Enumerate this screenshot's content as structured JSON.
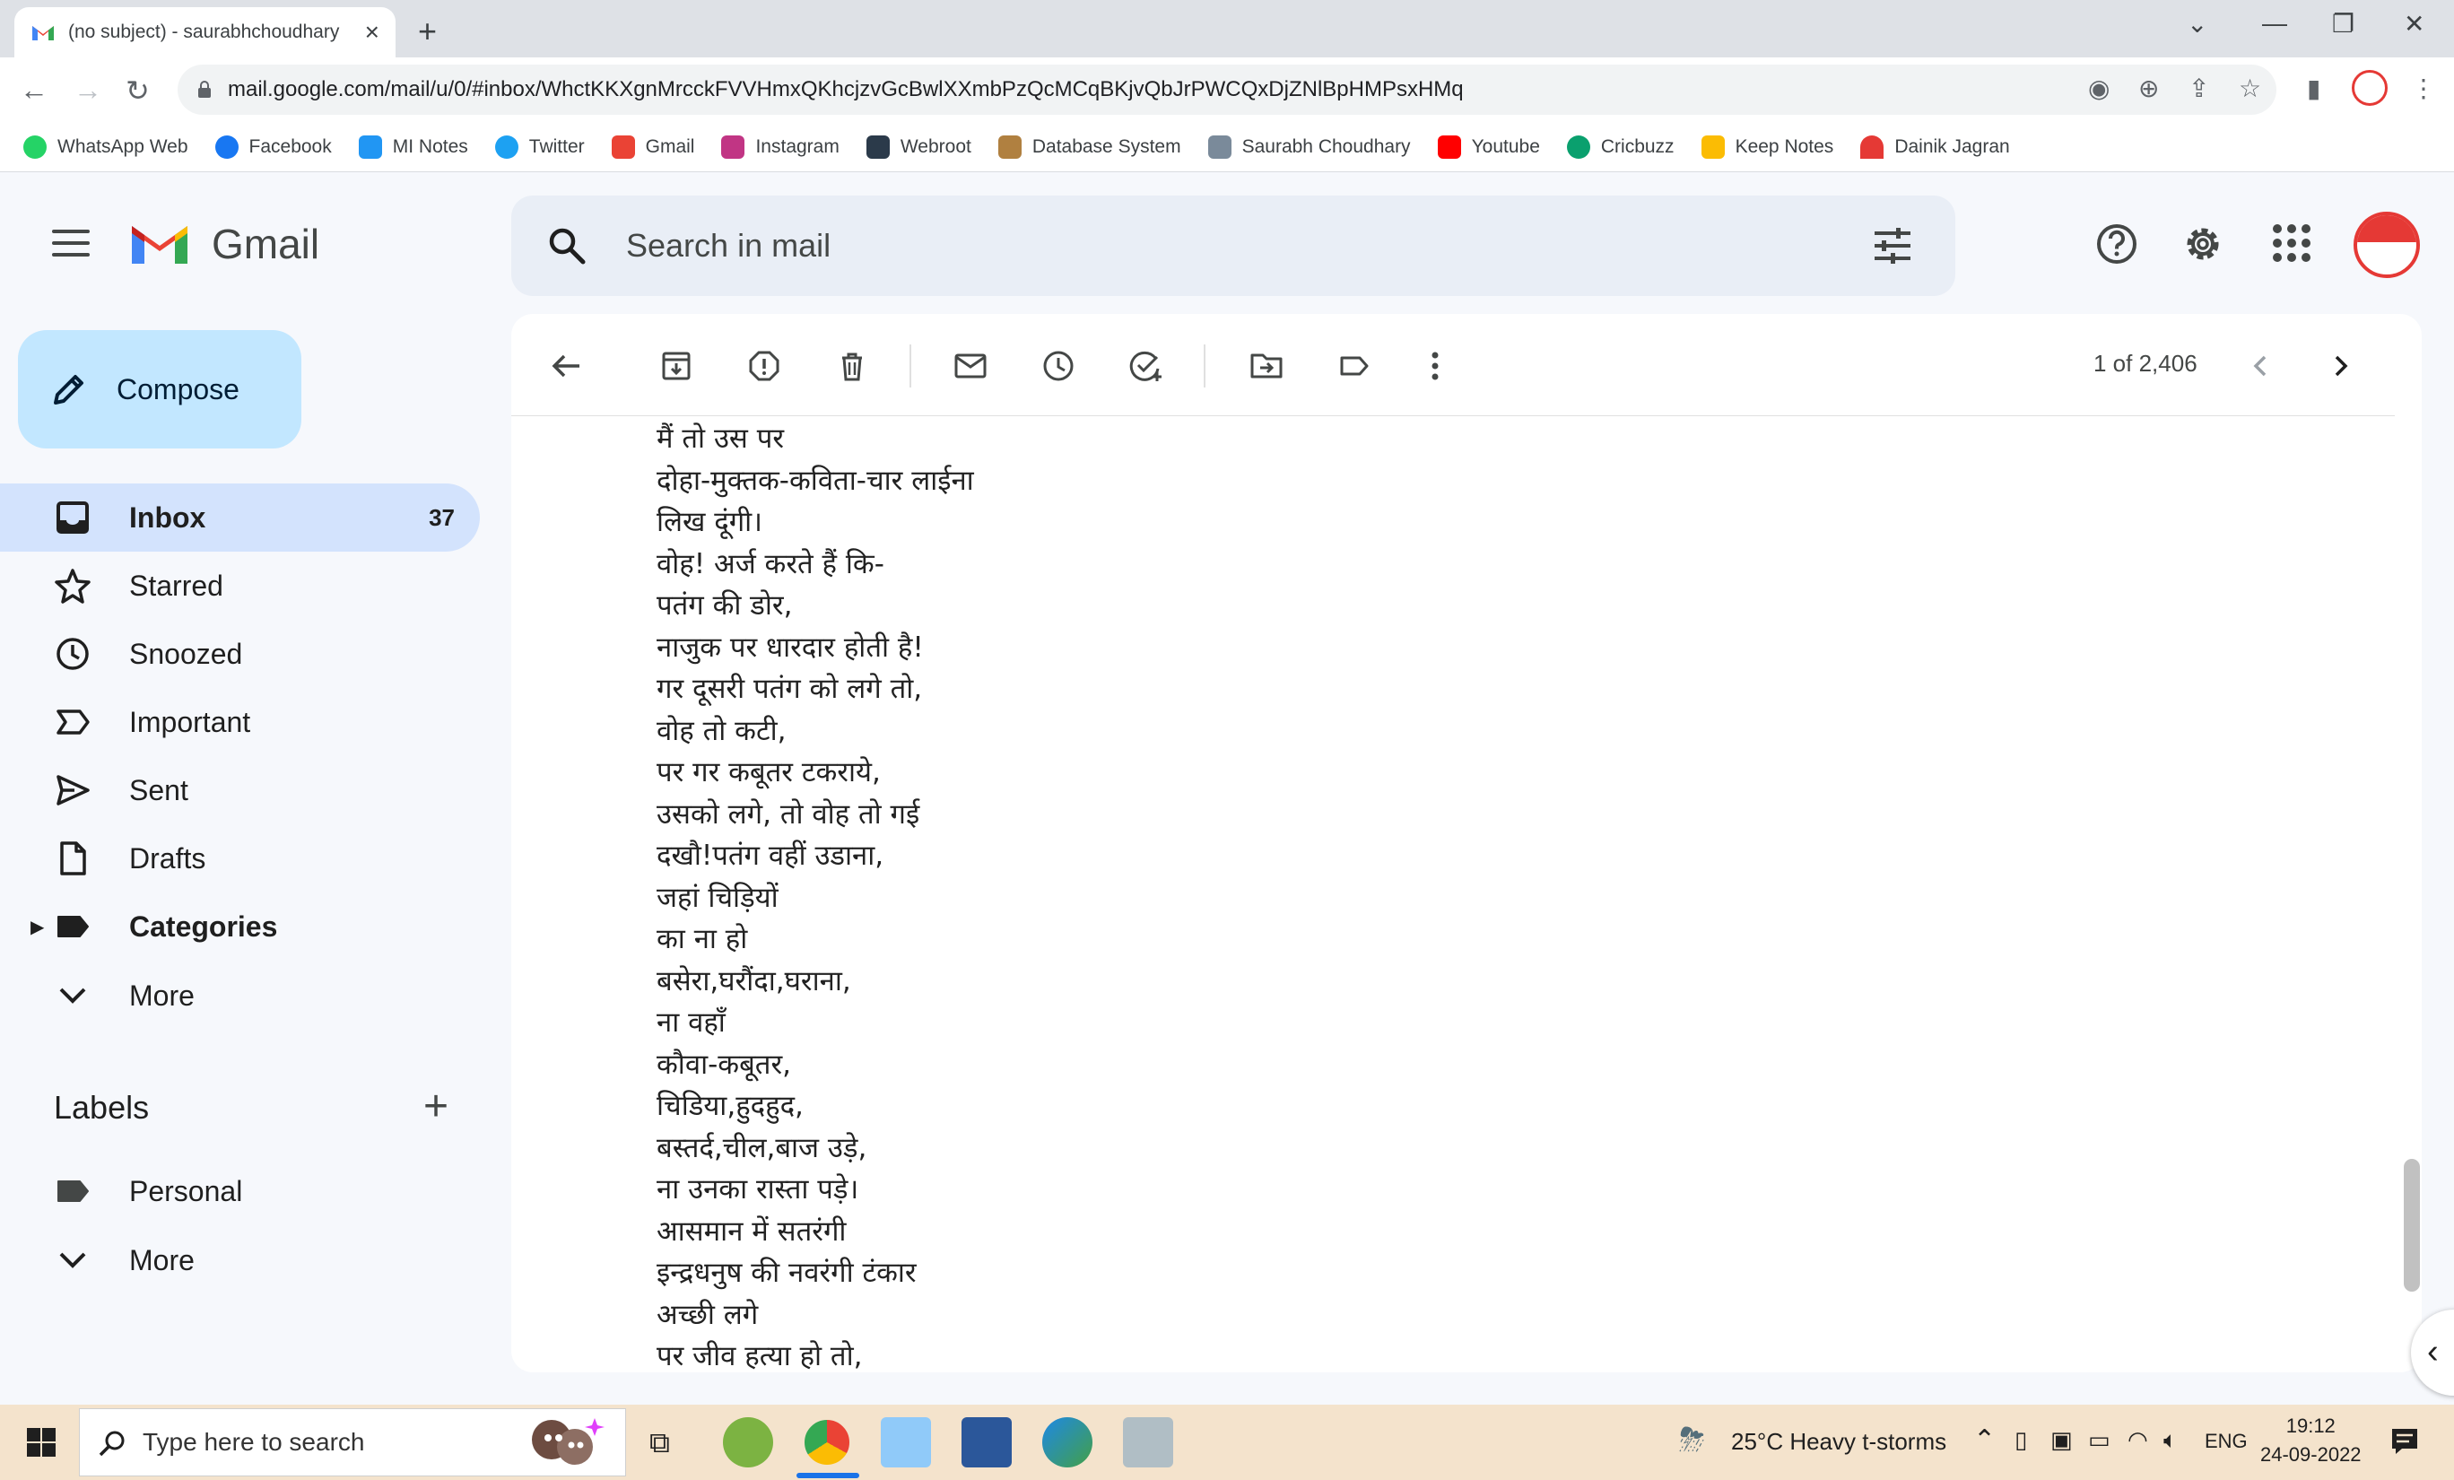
{
  "browser": {
    "tab_title": "(no subject) - saurabhchoudhary",
    "url": "mail.google.com/mail/u/0/#inbox/WhctKKXgnMrcckFVVHmxQKhcjzvGcBwlXXmbPzQcMCqBKjvQbJrPWCQxDjZNlBpHMPsxHMq",
    "bookmarks": [
      {
        "label": "WhatsApp Web",
        "icon": "whatsapp-icon",
        "color": "#25d366"
      },
      {
        "label": "Facebook",
        "icon": "facebook-icon",
        "color": "#1877f2"
      },
      {
        "label": "MI Notes",
        "icon": "cloud-notes-icon",
        "color": "#2196f3"
      },
      {
        "label": "Twitter",
        "icon": "twitter-icon",
        "color": "#1da1f2"
      },
      {
        "label": "Gmail",
        "icon": "gmail-icon",
        "color": "#ea4335"
      },
      {
        "label": "Instagram",
        "icon": "instagram-icon",
        "color": "#c13584"
      },
      {
        "label": "Webroot",
        "icon": "webroot-icon",
        "color": "#2b3a4a"
      },
      {
        "label": "Database System",
        "icon": "database-icon",
        "color": "#b08040"
      },
      {
        "label": "Saurabh Choudhary",
        "icon": "document-icon",
        "color": "#7a8a9a"
      },
      {
        "label": "Youtube",
        "icon": "youtube-icon",
        "color": "#ff0000"
      },
      {
        "label": "Cricbuzz",
        "icon": "cricbuzz-icon",
        "color": "#0aa06e"
      },
      {
        "label": "Keep Notes",
        "icon": "keep-icon",
        "color": "#fbbc04"
      },
      {
        "label": "Dainik Jagran",
        "icon": "jagran-icon",
        "color": "#e53935"
      }
    ]
  },
  "gmail": {
    "app_name": "Gmail",
    "search_placeholder": "Search in mail",
    "compose_label": "Compose",
    "nav": [
      {
        "label": "Inbox",
        "count": "37",
        "icon": "inbox-icon"
      },
      {
        "label": "Starred",
        "count": "",
        "icon": "star-icon"
      },
      {
        "label": "Snoozed",
        "count": "",
        "icon": "clock-icon"
      },
      {
        "label": "Important",
        "count": "",
        "icon": "important-icon"
      },
      {
        "label": "Sent",
        "count": "",
        "icon": "send-icon"
      },
      {
        "label": "Drafts",
        "count": "",
        "icon": "draft-icon"
      },
      {
        "label": "Categories",
        "count": "",
        "icon": "label-icon"
      },
      {
        "label": "More",
        "count": "",
        "icon": "chevron-down-icon"
      }
    ],
    "labels_title": "Labels",
    "labels": [
      {
        "label": "Personal",
        "icon": "label-icon"
      },
      {
        "label": "More",
        "icon": "chevron-down-icon"
      }
    ],
    "pager": "1 of 2,406"
  },
  "message": {
    "lines": [
      "मैं तो उस पर",
      "दोहा-मुक्तक-कविता-चार लाईना",
      "लिख दूंगी।",
      "वोह! अर्ज करते हैं कि-",
      "पतंग की डोर,",
      "नाजुक पर धारदार होती है!",
      "गर दूसरी पतंग को लगे तो,",
      "वोह तो कटी,",
      "पर गर कबूतर टकराये,",
      "उसको लगे, तो वोह तो गई",
      "दखौ!पतंग वहीं उडाना,",
      "जहां चिड़ियों",
      "का ना हो",
      "बसेरा,घरौंदा,घराना,",
      "ना वहाँ",
      "कौवा-कबूतर,",
      "चिडिया,हुदहुद,",
      "बस्तर्द,चील,बाज उड़े,",
      "ना उनका रास्ता पड़े।",
      "आसमान में सतरंगी",
      "इन्द्रधनुष की नवरंगी टंकार",
      "अच्छी लगे",
      "पर जीव हत्या हो तो,"
    ]
  },
  "taskbar": {
    "search_placeholder": "Type here to search",
    "weather": "25°C  Heavy t-storms",
    "language": "ENG",
    "time": "19:12",
    "date": "24-09-2022"
  }
}
